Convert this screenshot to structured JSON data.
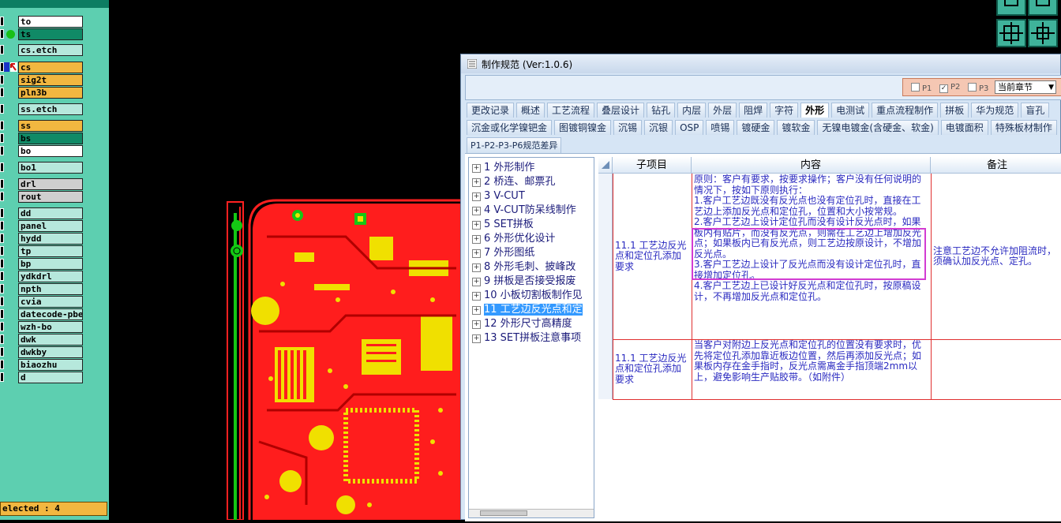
{
  "layer_panel": {
    "header_text": "",
    "layers": [
      {
        "name": "to",
        "style": "white"
      },
      {
        "name": "ts",
        "style": "dteal",
        "dot": true
      },
      {
        "name": "cs.etch",
        "style": "teal"
      },
      {
        "name": "cs",
        "style": "gold",
        "arrow": true
      },
      {
        "name": "sig2t",
        "style": "gold"
      },
      {
        "name": "pln3b",
        "style": "gold"
      },
      {
        "name": "ss.etch",
        "style": "teal"
      },
      {
        "name": "ss",
        "style": "gold"
      },
      {
        "name": "bs",
        "style": "dteal"
      },
      {
        "name": "bo",
        "style": "white"
      },
      {
        "name": "bo1",
        "style": "teal"
      },
      {
        "name": "drl",
        "style": "gray"
      },
      {
        "name": "rout",
        "style": "gray"
      },
      {
        "name": "dd",
        "style": "teal"
      },
      {
        "name": "panel",
        "style": "teal"
      },
      {
        "name": "hydd",
        "style": "teal"
      },
      {
        "name": "tp",
        "style": "teal"
      },
      {
        "name": "bp",
        "style": "teal"
      },
      {
        "name": "ydkdrl",
        "style": "teal"
      },
      {
        "name": "npth",
        "style": "teal"
      },
      {
        "name": "cvia",
        "style": "teal"
      },
      {
        "name": "datecode-pbe",
        "style": "teal"
      },
      {
        "name": "wzh-bo",
        "style": "teal"
      },
      {
        "name": "dwk",
        "style": "teal"
      },
      {
        "name": "dwkby",
        "style": "teal"
      },
      {
        "name": "biaozhu",
        "style": "teal"
      },
      {
        "name": "d",
        "style": "teal"
      }
    ],
    "status": "elected : 4"
  },
  "dialog": {
    "title": "制作规范 (Ver:1.0.6)",
    "filters": {
      "p1": "P1",
      "p2": "P2",
      "p3": "P3",
      "p2_checked": true
    },
    "chapter_select": "当前章节",
    "tabs_row1": [
      "更改记录",
      "概述",
      "工艺流程",
      "叠层设计",
      "钻孔",
      "内层",
      "外层",
      "阻焊",
      "字符",
      "外形",
      "电测试",
      "重点流程制作",
      "拼板",
      "华为规范",
      "盲孔"
    ],
    "active_tab": "外形",
    "tabs_row2": [
      "沉金或化学镍钯金",
      "图镀铜镍金",
      "沉锡",
      "沉银",
      "OSP",
      "喷锡",
      "镀硬金",
      "镀软金",
      "无镍电镀金(含硬金、软金)",
      "电镀面积",
      "特殊板材制作"
    ],
    "subtab": "P1-P2-P3-P6规范差异",
    "tree": [
      {
        "label": "1 外形制作"
      },
      {
        "label": "2 桥连、邮票孔"
      },
      {
        "label": "3 V-CUT"
      },
      {
        "label": "4 V-CUT防呆线制作"
      },
      {
        "label": "5 SET拼板"
      },
      {
        "label": "6 外形优化设计"
      },
      {
        "label": "7 外形图纸"
      },
      {
        "label": "8 外形毛刺、披峰改"
      },
      {
        "label": "9 拼板是否接受报废"
      },
      {
        "label": "10 小板切割板制作见"
      },
      {
        "label": "11 工艺边反光点和定",
        "selected": true
      },
      {
        "label": "12 外形尺寸高精度"
      },
      {
        "label": "13 SET拼板注意事项"
      }
    ],
    "grid": {
      "headers": [
        "子项目",
        "内容",
        "备注"
      ],
      "rows": [
        {
          "subitem": "11.1 工艺边反光点和定位孔添加要求",
          "content": "原则：客户有要求，按要求操作；客户没有任何说明的情况下，按如下原则执行：\n1.客户工艺边既没有反光点也没有定位孔时，直接在工艺边上添加反光点和定位孔，位置和大小按常规。\n2.客户工艺边上设计定位孔而没有设计反光点时，如果板内有贴片，而没有反光点，则需在工艺边上增加反光点；如果板内已有反光点，则工艺边按原设计，不增加反光点。\n3.客户工艺边上设计了反光点而没有设计定位孔时，直接增加定位孔。\n4.客户工艺边上已设计好反光点和定位孔时，按原稿设计，不再增加反光点和定位孔。",
          "note": "注意工艺边不允许加阻流时，须确认加反光点、定孔。"
        },
        {
          "subitem": "11.1 工艺边反光点和定位孔添加要求",
          "content": "当客户对附边上反光点和定位孔的位置没有要求时，优先将定位孔添加靠近板边位置，然后再添加反光点；如果板内存在金手指时，反光点需离金手指顶端2mm以上，避免影响生产贴胶带。（如附件）",
          "note": ""
        }
      ]
    }
  },
  "colors": {
    "panel_bg": "#5dcfb0",
    "pcb_red": "#ff1d1d",
    "pad_yellow": "#f0e000",
    "highlight": "#d23cd2",
    "grid_line": "#e03030"
  }
}
